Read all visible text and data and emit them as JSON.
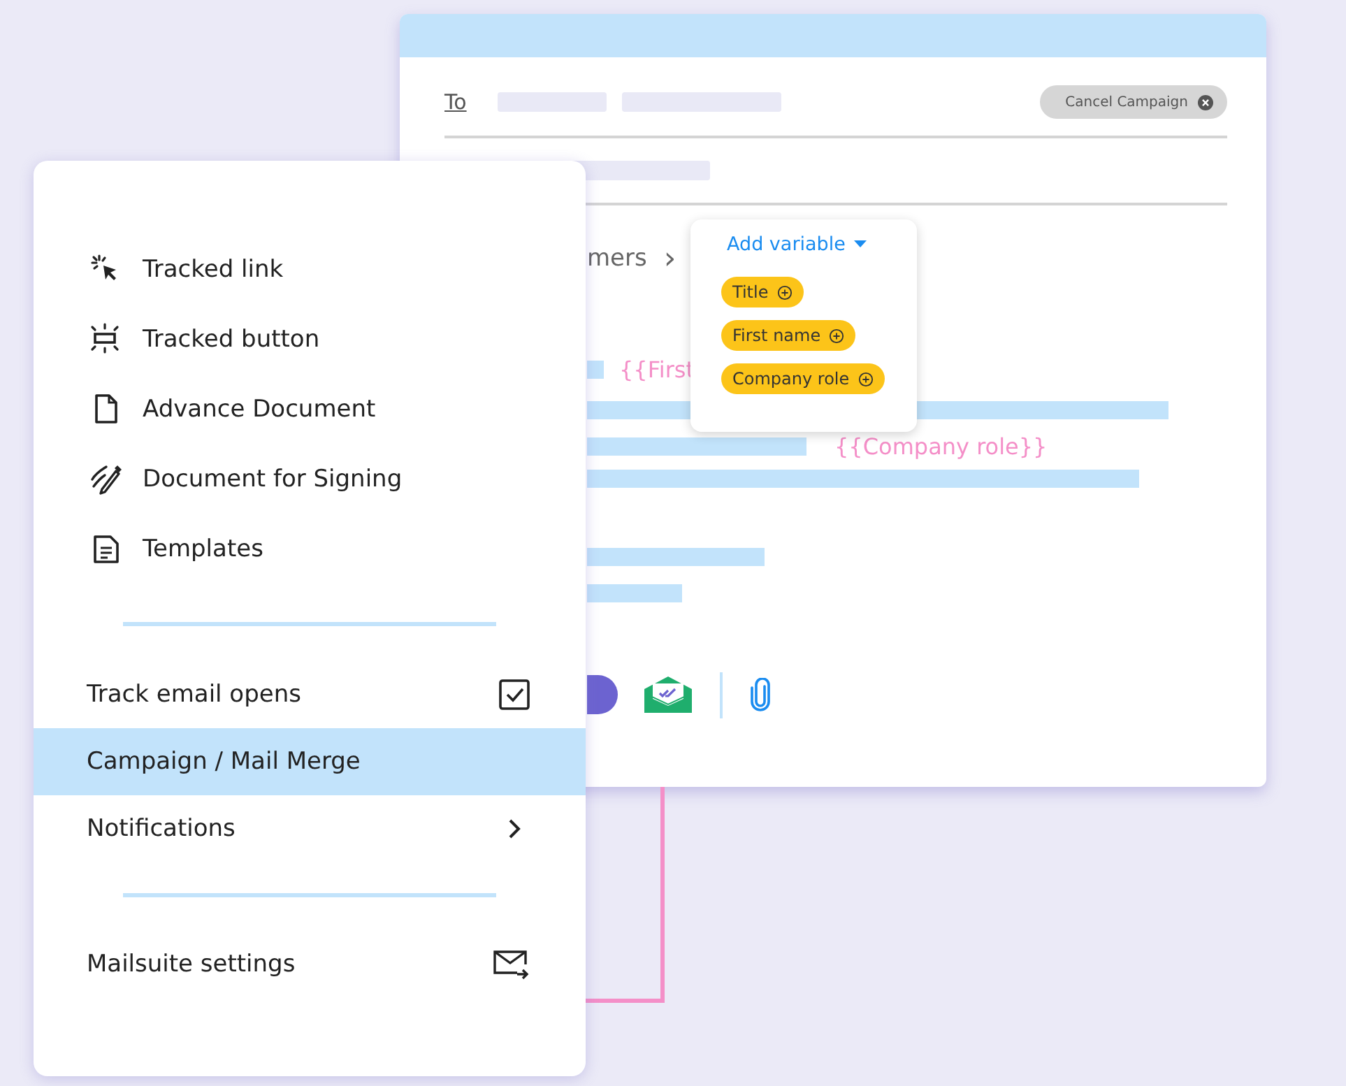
{
  "compose": {
    "to_label": "To",
    "cancel_button": "Cancel Campaign",
    "breadcrumb": "mers",
    "breadcrumb_arrow": "›",
    "variable_menu": {
      "label": "Add variable",
      "expanded": true,
      "chips": [
        "Title",
        "First name",
        "Company role"
      ]
    },
    "body_variables": [
      "{{First",
      "{{Company role}}"
    ]
  },
  "menu": {
    "tools": [
      {
        "label": "Tracked link",
        "kind": "cursor"
      },
      {
        "label": "Tracked button",
        "kind": "button"
      },
      {
        "label": "Advance Document",
        "kind": "file"
      },
      {
        "label": "Document for Signing",
        "kind": "pen"
      },
      {
        "label": "Templates",
        "kind": "template"
      }
    ],
    "options": [
      {
        "kind": "checkbox",
        "label": "Track email opens",
        "checked": true,
        "selected": false
      },
      {
        "kind": "plain",
        "label": "Campaign / Mail Merge",
        "selected": true
      },
      {
        "kind": "submenu",
        "label": "Notifications",
        "selected": false
      }
    ],
    "settings": {
      "label": "Mailsuite settings"
    }
  }
}
